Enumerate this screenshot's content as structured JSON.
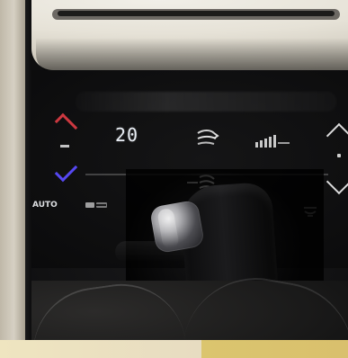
{
  "display": {
    "temperature_value": "20",
    "mode_auto_label": "AUTO"
  },
  "icons": {
    "temp_up": "arrow-up",
    "temp_down": "arrow-down",
    "fan": "fan",
    "fan_level": "fan-speed-bars",
    "fan_up": "chevron-up",
    "fan_down": "chevron-down",
    "recirculation": "recirculation",
    "defrost": "defrost",
    "airflow_lower": "airflow-lower"
  },
  "colors": {
    "temp_up_red": "#d83b43",
    "temp_down_blue": "#5a4cff",
    "panel_text": "#e9eef5",
    "bottom_strip_left": "#efe5c0",
    "bottom_strip_right": "#dbc56e"
  },
  "status": {
    "fan_level_fraction": 0.75
  }
}
